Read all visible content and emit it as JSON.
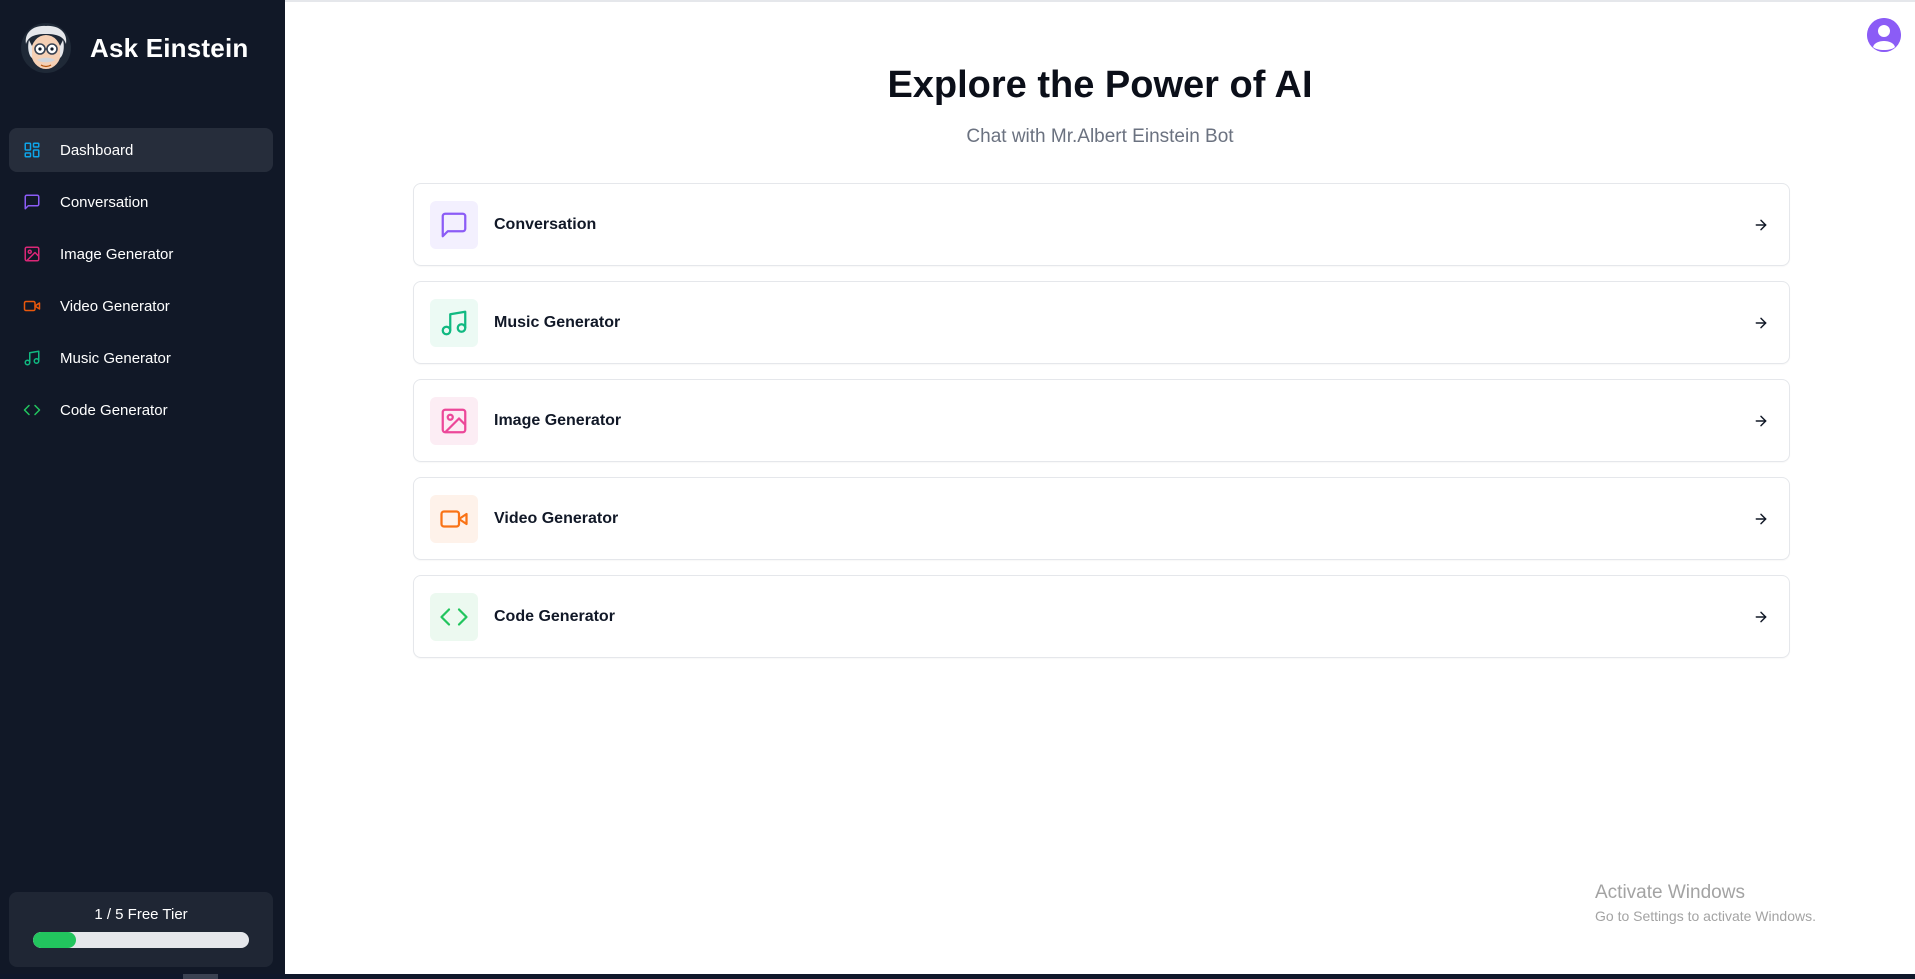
{
  "brand": {
    "name": "Ask Einstein",
    "logo_icon": "einstein-avatar-icon"
  },
  "sidebar": {
    "items": [
      {
        "label": "Dashboard",
        "icon": "dashboard-grid-icon",
        "color": "#0ea5e9",
        "active": true
      },
      {
        "label": "Conversation",
        "icon": "chat-bubble-icon",
        "color": "#8b5cf6",
        "active": false
      },
      {
        "label": "Image Generator",
        "icon": "image-icon",
        "color": "#db2777",
        "active": false
      },
      {
        "label": "Video Generator",
        "icon": "video-camera-icon",
        "color": "#ea580c",
        "active": false
      },
      {
        "label": "Music Generator",
        "icon": "music-note-icon",
        "color": "#10b981",
        "active": false
      },
      {
        "label": "Code Generator",
        "icon": "code-brackets-icon",
        "color": "#22c55e",
        "active": false
      }
    ],
    "tier": {
      "label": "1 / 5 Free Tier",
      "progress": 0.2
    }
  },
  "header": {
    "avatar_icon": "user-avatar-icon"
  },
  "main": {
    "title": "Explore the Power of AI",
    "subtitle": "Chat with Mr.Albert Einstein Bot",
    "cards": [
      {
        "label": "Conversation",
        "icon": "chat-bubble-icon",
        "color": "#8b5cf6",
        "bg": "#f3f0fe"
      },
      {
        "label": "Music Generator",
        "icon": "music-note-icon",
        "color": "#10b981",
        "bg": "#ecfaf4"
      },
      {
        "label": "Image Generator",
        "icon": "image-icon",
        "color": "#ec4899",
        "bg": "#fcedf4"
      },
      {
        "label": "Video Generator",
        "icon": "video-camera-icon",
        "color": "#f97316",
        "bg": "#fef2ea"
      },
      {
        "label": "Code Generator",
        "icon": "code-brackets-icon",
        "color": "#22c55e",
        "bg": "#ecf9f0"
      }
    ]
  },
  "watermark": {
    "line1": "Activate Windows",
    "line2": "Go to Settings to activate Windows."
  }
}
